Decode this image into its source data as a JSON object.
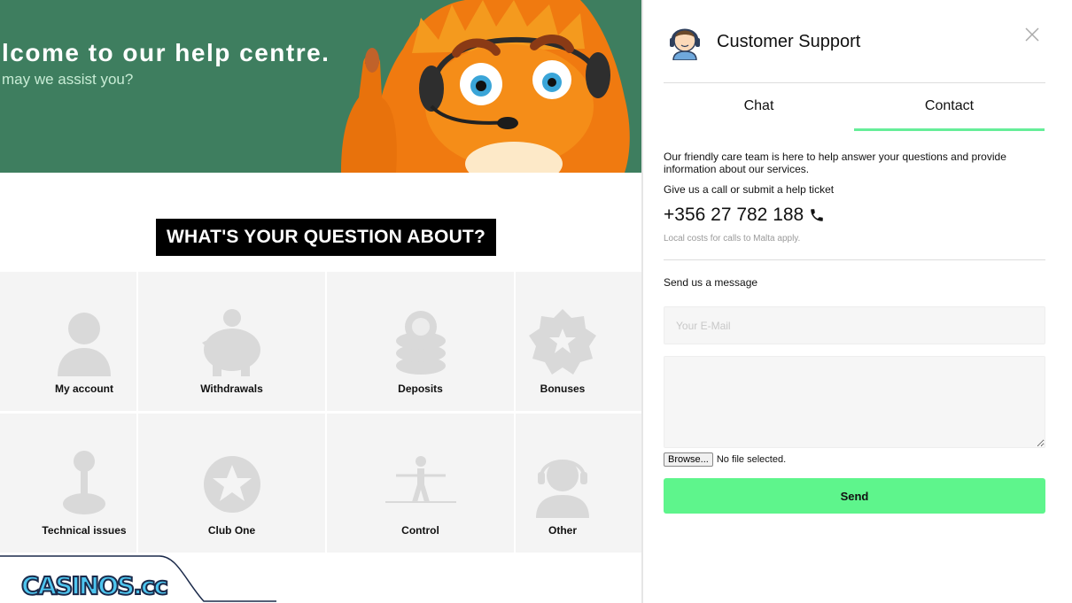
{
  "hero": {
    "title": "lcome to our help centre.",
    "subtitle": "may we assist you?"
  },
  "question_banner": "WHAT'S YOUR QUESTION ABOUT?",
  "categories": [
    {
      "label": "My account",
      "icon": "user-icon"
    },
    {
      "label": "Withdrawals",
      "icon": "piggy-bank-icon"
    },
    {
      "label": "Deposits",
      "icon": "coins-icon"
    },
    {
      "label": "Bonuses",
      "icon": "badge-star-icon"
    },
    {
      "label": "Technical issues",
      "icon": "joystick-icon"
    },
    {
      "label": "Club One",
      "icon": "star-circle-icon"
    },
    {
      "label": "Control",
      "icon": "tightrope-icon"
    },
    {
      "label": "Other",
      "icon": "headset-agent-icon"
    }
  ],
  "watermark": {
    "text": "CASINOS.cc"
  },
  "panel": {
    "title": "Customer Support",
    "tabs": [
      {
        "label": "Chat",
        "active": false
      },
      {
        "label": "Contact",
        "active": true
      }
    ],
    "intro": "Our friendly care team is here to help answer your questions and provide information about our services.",
    "give_call": "Give us a call or submit a help ticket",
    "phone": "+356 27 782 188",
    "phone_note": "Local costs for calls to Malta apply.",
    "send_message_label": "Send us a message",
    "email_placeholder": "Your E-Mail",
    "browse_label": "Browse...",
    "file_status": "No file selected.",
    "send_label": "Send"
  },
  "colors": {
    "hero_bg": "#3e7e5f",
    "accent_green": "#5ef58c",
    "tile_bg": "#f4f4f4",
    "icon_gray": "#d9d9d9"
  }
}
